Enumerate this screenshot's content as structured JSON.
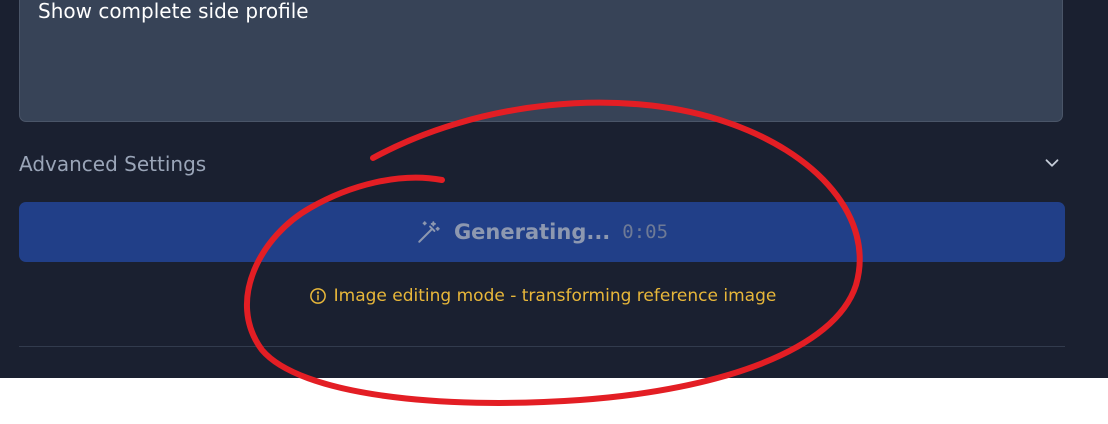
{
  "prompt": {
    "value": "Show complete side profile"
  },
  "advanced_settings": {
    "label": "Advanced Settings",
    "icon": "chevron-down-icon"
  },
  "generate_button": {
    "label": "Generating...",
    "timer": "0:05",
    "icon": "magic-wand-icon"
  },
  "info": {
    "text": "Image editing mode - transforming reference image",
    "icon": "info-icon"
  },
  "colors": {
    "background": "#1a2030",
    "prompt_box": "#374357",
    "button": "#213f88",
    "info_text": "#e8b73a",
    "annotation": "#e31e24"
  }
}
